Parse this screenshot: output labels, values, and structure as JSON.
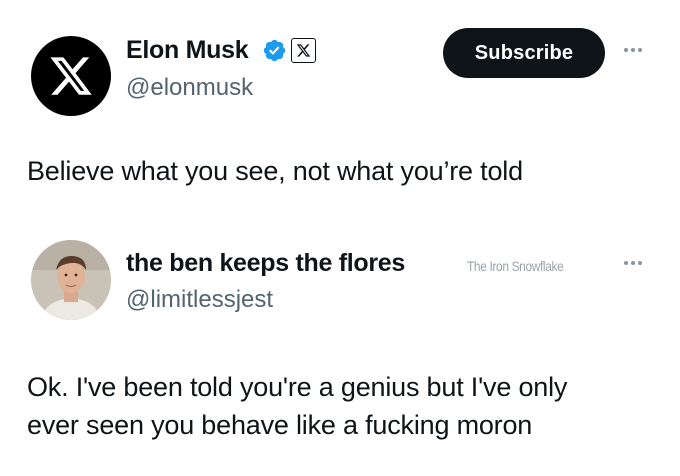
{
  "tweet": {
    "author_name": "Elon Musk",
    "author_handle": "@elonmusk",
    "avatar_icon": "x-logo-icon",
    "verified_badge_icon": "verified-badge-icon",
    "affiliation_badge_icon": "x-affiliation-icon",
    "subscribe_label": "Subscribe",
    "more_icon": "more-options-icon",
    "text": "Believe what you see, not what you’re told",
    "colors": {
      "verified": "#1d9bf0",
      "button_bg": "#0f1419",
      "handle": "#536471"
    }
  },
  "reply": {
    "author_name": "the ben keeps the flores",
    "author_handle": "@limitlessjest",
    "watermark": "The Iron Snowflake",
    "more_icon": "more-options-icon",
    "text_lines": [
      "Ok. I've been told you're a genius but I've only",
      "ever seen you behave like a fucking moron"
    ]
  }
}
